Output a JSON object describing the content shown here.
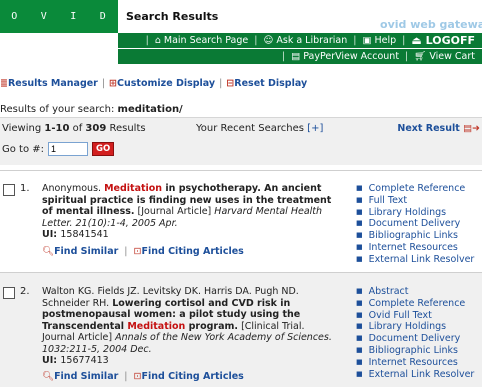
{
  "header": {
    "logo_letters": [
      "O",
      "V",
      "I",
      "D"
    ],
    "page_title": "Search Results",
    "gateway_text": "ovid web gateway",
    "nav_primary": [
      "Main Search Page",
      "Ask a Librarian",
      "Help",
      "LOGOFF"
    ],
    "nav_secondary": [
      "PayPerView Account",
      "View Cart"
    ]
  },
  "toolbar": {
    "results_manager": "Results Manager",
    "customize_display": "Customize Display",
    "reset_display": "Reset Display"
  },
  "search": {
    "prefix": "Results of your search: ",
    "query": "meditation/"
  },
  "paging": {
    "viewing_prefix": "Viewing ",
    "range": "1-10",
    "of_text": " of ",
    "total": "309",
    "results_word": " Results",
    "recent_label": "Your Recent Searches",
    "recent_plus": "[+]",
    "next_result": "Next Result",
    "goto_label": "Go to #:",
    "goto_value": "1",
    "go_button": "GO"
  },
  "records": [
    {
      "number": "1.",
      "authors": "Anonymous.",
      "title_pre": "",
      "title_hl": "Meditation",
      "title_post": " in psychotherapy. An ancient spiritual practice is finding new uses in the treatment of mental illness.",
      "type": " [Journal Article] ",
      "journal": "Harvard Mental Health Letter. 21(10):1-4, 2005 Apr.",
      "ui_label": "UI: ",
      "ui": "15841541",
      "find_similar": "Find Similar",
      "find_citing": "Find Citing Articles",
      "links": [
        "Complete Reference",
        "Full Text",
        "Library Holdings",
        "Document Delivery",
        "Bibliographic Links",
        "Internet Resources",
        "External Link Resolver"
      ]
    },
    {
      "number": "2.",
      "authors": "Walton KG. Fields JZ. Levitsky DK. Harris DA. Pugh ND. Schneider RH.",
      "title_pre": "Lowering cortisol and CVD risk in postmenopausal women: a pilot study using the Transcendental ",
      "title_hl": "Meditation",
      "title_post": " program.",
      "type": " [Clinical Trial. Journal Article] ",
      "journal": "Annals of the New York Academy of Sciences. 1032:211-5, 2004 Dec.",
      "ui_label": "UI: ",
      "ui": "15677413",
      "find_similar": "Find Similar",
      "find_citing": "Find Citing Articles",
      "links": [
        "Abstract",
        "Complete Reference",
        "Ovid Full Text",
        "Library Holdings",
        "Document Delivery",
        "Bibliographic Links",
        "Internet Resources",
        "External Link Resolver"
      ]
    }
  ],
  "colors": {
    "brand_green": "#0a7a35",
    "link_blue": "#1d4f9a",
    "highlight_red": "#c41111",
    "go_red": "#d21f1f"
  }
}
